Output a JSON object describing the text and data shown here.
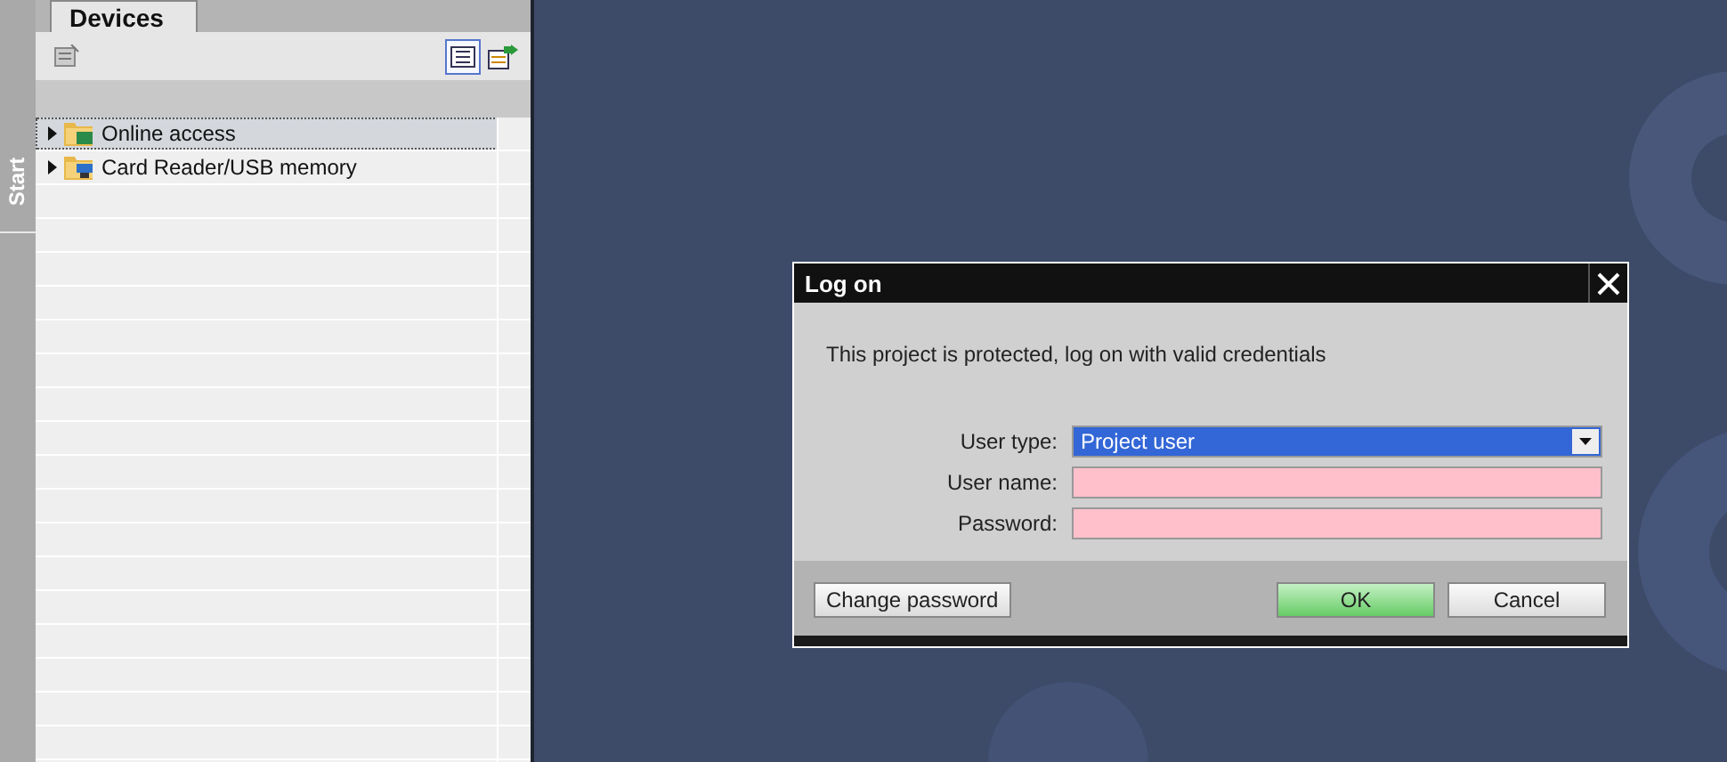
{
  "side_tab": {
    "label": "Start"
  },
  "devices_panel": {
    "tab": {
      "label": "Devices",
      "selected": true
    },
    "view_buttons": [
      {
        "selected": true
      },
      {
        "selected": false
      }
    ],
    "tree": [
      {
        "label": "Online access",
        "expanded": false,
        "selected": true
      },
      {
        "label": "Card Reader/USB memory",
        "expanded": false,
        "selected": false
      }
    ]
  },
  "dialog": {
    "title": "Log on",
    "message": "This project is protected, log on with valid credentials",
    "fields": [
      {
        "label": "User type:",
        "kind": "dropdown",
        "value": "Project user"
      },
      {
        "label": "User name:",
        "kind": "text"
      },
      {
        "label": "Password:",
        "kind": "password"
      }
    ],
    "buttons": [
      {
        "label": "Change password",
        "kind": "secondary"
      },
      {
        "label": "OK",
        "kind": "primary"
      },
      {
        "label": "Cancel",
        "kind": "secondary"
      }
    ]
  }
}
